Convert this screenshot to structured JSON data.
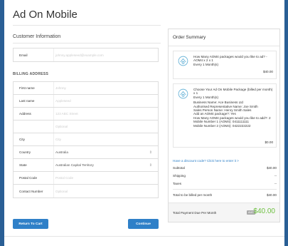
{
  "page": {
    "title": "Ad On Mobile"
  },
  "customer": {
    "heading": "Customer Information",
    "email_label": "Email",
    "email_placeholder": "johnny.appleseed@example.com"
  },
  "billing": {
    "heading": "BILLING ADDRESS",
    "first_name_label": "First name",
    "first_name_placeholder": "Johnny",
    "last_name_label": "Last name",
    "last_name_placeholder": "Appleseed",
    "address_label": "Address",
    "address_placeholder": "123 ABC Street",
    "address2_placeholder": "Optional",
    "city_label": "City",
    "city_placeholder": "City",
    "country_label": "Country",
    "country_value": "Australia",
    "state_label": "State",
    "state_value": "Australian Capital Territory",
    "postal_label": "Postal Code",
    "postal_placeholder": "Postal Code",
    "contact_label": "Contact Number",
    "contact_placeholder": "Optional"
  },
  "buttons": {
    "return": "Return To Cart",
    "continue": "Continue"
  },
  "summary": {
    "heading": "Order Summary",
    "item1": {
      "title": "How Many AOM4 packages would you like to ad? - AOM4 x 2 x 1",
      "freq": "Every 1 Month(s)",
      "price": "$40.00"
    },
    "item2": {
      "title": "Choose Your Ad On Mobile Package (billed per month) x 1",
      "freq": "Every 1 Month(s)",
      "details": [
        "Business Name: Ace Business Ltd",
        "Authorised Representative Name: Joe Smith",
        "Sales Person Name: Henry Smith Sales",
        "Add an AOM4 package?: Yes",
        "How Many AOM4 packages would you like to add?: 2",
        "Mobile Number 1 (AOM4): 0411111111",
        "Mobile Number 2 (AOM4): 0422222222"
      ],
      "price": "$0.00"
    },
    "discount_link": "Have a discount code? Click here to enter it",
    "subtotal_label": "Subtotal",
    "subtotal_value": "$40.00",
    "shipping_label": "Shipping",
    "shipping_value": "--",
    "taxes_label": "Taxes",
    "taxes_value": "--",
    "monthly_label": "Total to be billed per month",
    "monthly_value": "$40.00",
    "due_label": "Total Payment Due Per Month",
    "due_currency": "AUD",
    "due_value": "$40.00"
  },
  "colors": {
    "accent": "#2f80c8",
    "total": "#6cbf3f",
    "outer": "#2a5f95"
  }
}
